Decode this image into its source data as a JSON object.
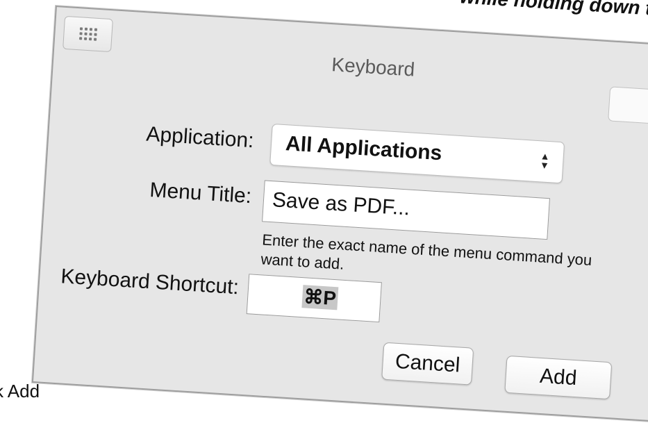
{
  "background": {
    "top_text": "while holding down t",
    "bottom_text": "k Add"
  },
  "window": {
    "title": "Keyboard",
    "grid_icon": "grid-dots-icon"
  },
  "form": {
    "application_label": "Application:",
    "application_value": "All Applications",
    "menu_title_label": "Menu Title:",
    "menu_title_value": "Save as PDF...",
    "hint": "Enter the exact name of the menu command you want to add.",
    "shortcut_label": "Keyboard Shortcut:",
    "shortcut_value": "⌘P"
  },
  "buttons": {
    "cancel": "Cancel",
    "add": "Add"
  }
}
